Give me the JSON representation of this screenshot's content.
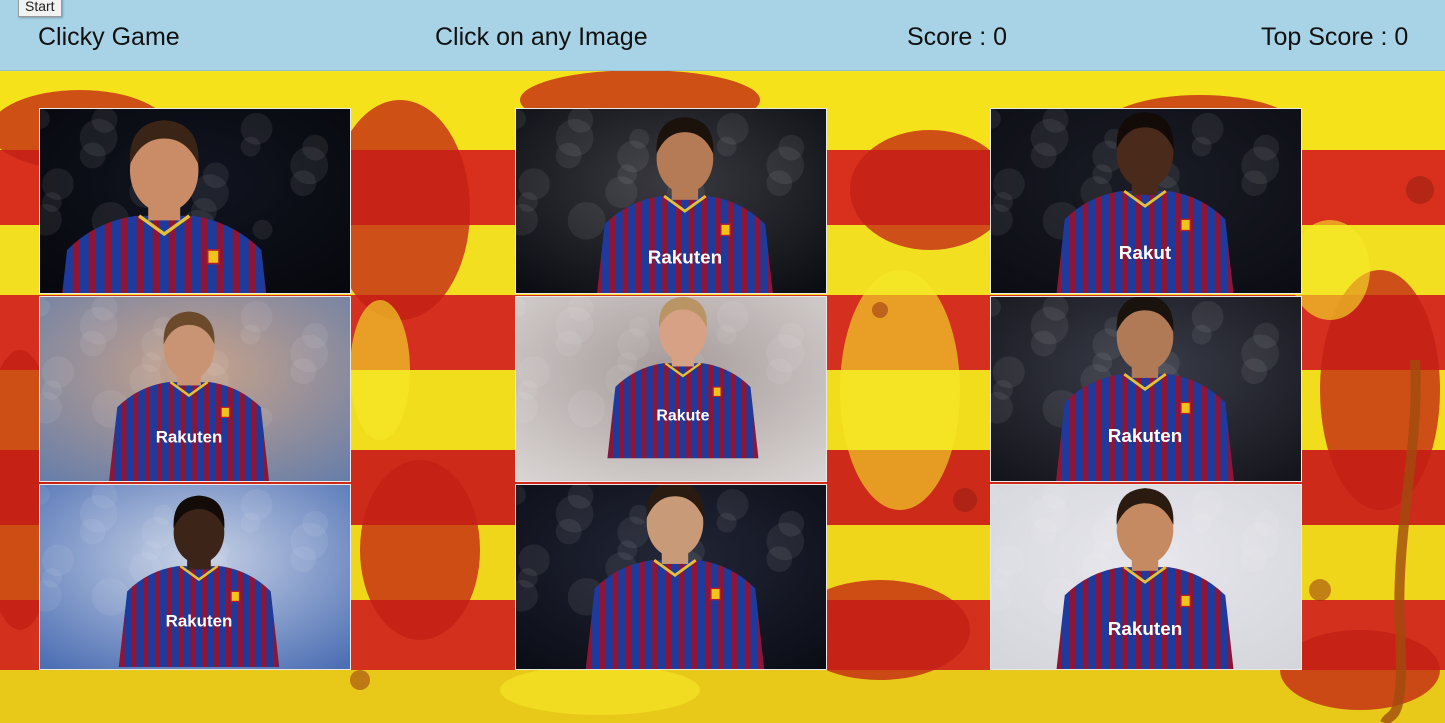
{
  "overlay": {
    "start_label": "Start"
  },
  "navbar": {
    "brand": "Clicky Game",
    "instruction": "Click on any Image",
    "score_label": "Score : 0",
    "top_score_label": "Top Score : 0"
  },
  "colors": {
    "navbar_bg": "#a8d3e6",
    "stripe_yellow": "#f6e21a",
    "stripe_red": "#d8301c",
    "kit_blue": "#1d3a9c",
    "kit_garnet": "#8e1535"
  },
  "cards": [
    {
      "id": 1,
      "bg": "#07080d",
      "bg2": "#111420",
      "skin": "#c98c67",
      "hair": "#3a2416",
      "sponsor": ""
    },
    {
      "id": 2,
      "bg": "#0b0d12",
      "bg2": "#3a3a40",
      "skin": "#b57b56",
      "hair": "#1b120c",
      "sponsor": "Rakuten"
    },
    {
      "id": 3,
      "bg": "#0c0d14",
      "bg2": "#1a1c26",
      "skin": "#4a2a1b",
      "hair": "#120b07",
      "sponsor": "Rakut"
    },
    {
      "id": 4,
      "bg": "#6a7fa8",
      "bg2": "#c9a38a",
      "skin": "#c99473",
      "hair": "#6b4a2c",
      "sponsor": "Rakuten"
    },
    {
      "id": 5,
      "bg": "#d8d3d2",
      "bg2": "#a59a9a",
      "skin": "#d6a184",
      "hair": "#b99566",
      "sponsor": "Rakute"
    },
    {
      "id": 6,
      "bg": "#14151c",
      "bg2": "#3a3c48",
      "skin": "#b07a57",
      "hair": "#1a120c",
      "sponsor": "Rakuten"
    },
    {
      "id": 7,
      "bg": "#4d6fb4",
      "bg2": "#c9d3e6",
      "skin": "#3d2418",
      "hair": "#120b07",
      "sponsor": "Rakuten"
    },
    {
      "id": 8,
      "bg": "#0b0d16",
      "bg2": "#222636",
      "skin": "#c99a78",
      "hair": "#2a1b10",
      "sponsor": ""
    },
    {
      "id": 9,
      "bg": "#d5d5dc",
      "bg2": "#e6e6ec",
      "skin": "#c68a63",
      "hair": "#2a1a10",
      "sponsor": "Rakuten"
    }
  ]
}
